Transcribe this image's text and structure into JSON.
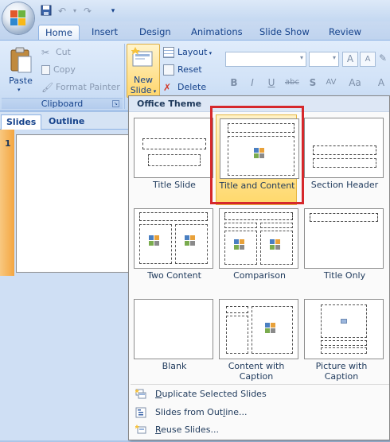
{
  "ribbon_tabs": [
    "Home",
    "Insert",
    "Design",
    "Animations",
    "Slide Show",
    "Review"
  ],
  "clipboard": {
    "paste": "Paste",
    "cut": "Cut",
    "copy": "Copy",
    "format_painter": "Format Painter",
    "group_label": "Clipboard"
  },
  "slides_group": {
    "new_slide_line1": "New",
    "new_slide_line2": "Slide",
    "layout": "Layout",
    "reset": "Reset",
    "delete": "Delete"
  },
  "font_group": {
    "bold": "B",
    "italic": "I",
    "underline": "U",
    "strike": "abc",
    "shadow": "S",
    "spacing": "AV",
    "case": "Aa",
    "grow": "A",
    "shrink": "A",
    "color": "A"
  },
  "panel_tabs": {
    "slides": "Slides",
    "outline": "Outline"
  },
  "thumbnail_number": "1",
  "layout_menu": {
    "header": "Office Theme",
    "layouts": [
      "Title Slide",
      "Title and Content",
      "Section Header",
      "Two Content",
      "Comparison",
      "Title Only",
      "Blank",
      "Content with Caption",
      "Picture with Caption"
    ],
    "selected": "Title and Content"
  },
  "menu_commands": {
    "duplicate_pre": "",
    "duplicate_u": "D",
    "duplicate_post": "uplicate Selected Slides",
    "outline_pre": "Slides from Out",
    "outline_u": "l",
    "outline_post": "ine...",
    "reuse_pre": "",
    "reuse_u": "R",
    "reuse_post": "euse Slides..."
  },
  "colors": {
    "accent": "#15428b",
    "selection": "#ffd86b",
    "highlight_border": "#d6282b"
  }
}
